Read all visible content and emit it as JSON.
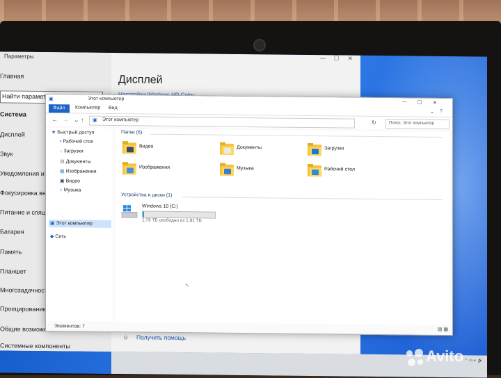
{
  "settings": {
    "window_title": "Параметры",
    "home_label": "Главная",
    "search_text": "Найти параметр",
    "section_label": "Система",
    "items": [
      "Дисплей",
      "Звук",
      "Уведомления и действия",
      "Фокусировка внимания",
      "Питание и спящий режим",
      "Батарея",
      "Память",
      "Планшет",
      "Многозадачность",
      "Проецирование на этот компьютер",
      "Общие возможности",
      "Системные компоненты"
    ],
    "page_header": "Дисплей",
    "link_text": "Настройки Windows HD Color",
    "help_link": "Получить помощь"
  },
  "explorer": {
    "window_title": "Этот компьютер",
    "ribbon_tabs": [
      "Файл",
      "Компьютер",
      "Вид"
    ],
    "address": "Этот компьютер",
    "search_placeholder": "Поиск: Этот компьютер",
    "nav": {
      "quick_access": "Быстрый доступ",
      "quick_items": [
        "Рабочий стол",
        "Загрузки",
        "Документы",
        "Изображения",
        "Видео",
        "Музыка"
      ],
      "this_pc": "Этот компьютер",
      "network": "Сеть"
    },
    "folders_header": "Папки (6)",
    "folders": [
      {
        "name": "Видео",
        "icon": "video-folder-icon",
        "badge": "#3a4a6a"
      },
      {
        "name": "Документы",
        "icon": "documents-folder-icon",
        "badge": "#e8e8e8"
      },
      {
        "name": "Загрузки",
        "icon": "downloads-folder-icon",
        "badge": "#1e78d7"
      },
      {
        "name": "Изображения",
        "icon": "pictures-folder-icon",
        "badge": "#4a90d9"
      },
      {
        "name": "Музыка",
        "icon": "music-folder-icon",
        "badge": "#3b7bd4"
      },
      {
        "name": "Рабочий стол",
        "icon": "desktop-folder-icon",
        "badge": "#2e88e0"
      }
    ],
    "devices_header": "Устройства и диски (1)",
    "drive": {
      "name": "Windows 10 (C:)",
      "free_text": "1,79 ТБ свободно из 1,81 ТБ",
      "used_fraction": 0.011
    },
    "status_text": "Элементов: 7"
  },
  "watermark": "Avito",
  "colors": {
    "accent": "#1d63c8",
    "folder": "#f3c53e",
    "drive_bar": "#26a0da"
  }
}
